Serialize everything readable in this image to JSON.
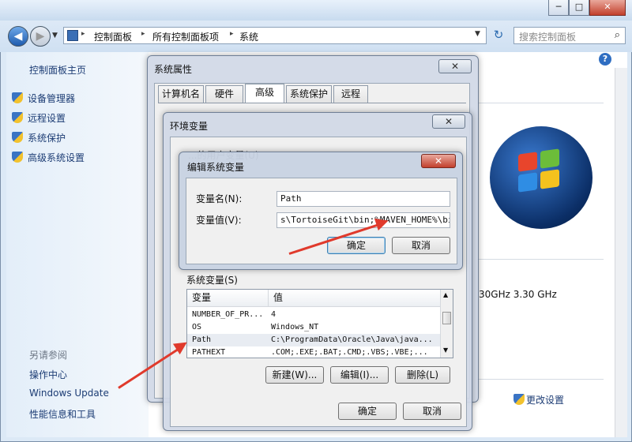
{
  "window": {
    "minimize": "─",
    "maximize": "□",
    "close": "✕"
  },
  "address": {
    "crumbs": [
      "控制面板",
      "所有控制面板项",
      "系统"
    ],
    "separator": "▸",
    "search_placeholder": "搜索控制面板"
  },
  "left_pane": {
    "home": "控制面板主页",
    "items": [
      "设备管理器",
      "远程设置",
      "系统保护",
      "高级系统设置"
    ],
    "see_also_title": "另请参阅",
    "see_also": [
      "操作中心",
      "Windows Update",
      "性能信息和工具"
    ]
  },
  "main": {
    "cpu_speed": "30GHz   3.30 GHz",
    "change_settings": "更改设置"
  },
  "sys_props": {
    "title": "系统属性",
    "tabs": [
      "计算机名",
      "硬件",
      "高级",
      "系统保护",
      "远程"
    ]
  },
  "env_vars": {
    "title": "环境变量",
    "user_vars_label": "...的用户变量(U)",
    "system_vars_label": "系统变量(S)",
    "columns": [
      "变量",
      "值"
    ],
    "rows": [
      {
        "name": "NUMBER_OF_PR...",
        "value": "4"
      },
      {
        "name": "OS",
        "value": "Windows_NT"
      },
      {
        "name": "Path",
        "value": "C:\\ProgramData\\Oracle\\Java\\java..."
      },
      {
        "name": "PATHEXT",
        "value": ".COM;.EXE;.BAT;.CMD;.VBS;.VBE;..."
      }
    ],
    "new_button": "新建(W)...",
    "edit_button": "编辑(I)...",
    "delete_button": "删除(L)",
    "ok": "确定",
    "cancel": "取消"
  },
  "edit_var": {
    "title": "编辑系统变量",
    "name_label": "变量名(N):",
    "name_value": "Path",
    "value_label": "变量值(V):",
    "value_value": "s\\TortoiseGit\\bin;%MAVEN_HOME%\\bin;",
    "ok": "确定",
    "cancel": "取消"
  },
  "colors": {
    "arrow": "#e03a2c",
    "link": "#1c3c74"
  }
}
